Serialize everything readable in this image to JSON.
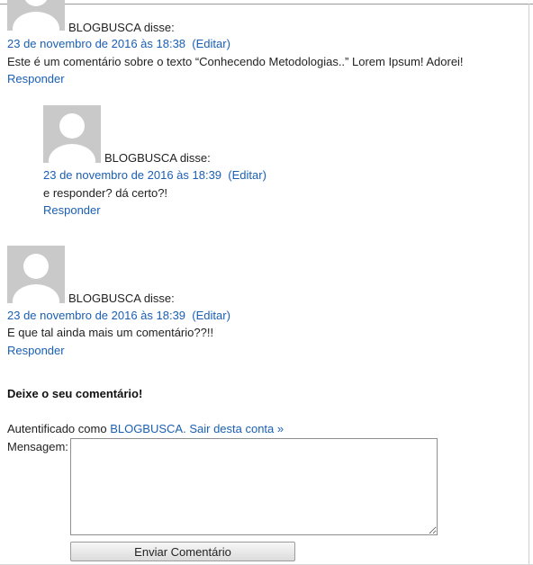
{
  "comments": [
    {
      "author": "BLOGBUSCA",
      "says": " disse:",
      "date": "23 de novembro de 2016 às 18:38",
      "edit": "(Editar)",
      "text": "Este é um comentário sobre o texto “Conhecendo Metodologias..” Lorem Ipsum! Adorei!",
      "reply": "Responder"
    },
    {
      "author": "BLOGBUSCA",
      "says": " disse:",
      "date": "23 de novembro de 2016 às 18:39",
      "edit": "(Editar)",
      "text": "e responder? dá certo?!",
      "reply": "Responder"
    },
    {
      "author": "BLOGBUSCA",
      "says": " disse:",
      "date": "23 de novembro de 2016 às 18:39",
      "edit": "(Editar)",
      "text": "E que tal ainda mais um comentário??!!",
      "reply": "Responder"
    }
  ],
  "form": {
    "title": "Deixe o seu comentário!",
    "logged_prefix": "Autentificado como ",
    "logged_user": "BLOGBUSCA",
    "logout_link": ". Sair desta conta »",
    "message_label": "Mensagem:",
    "message_value": "",
    "submit_label": "Enviar Comentário"
  },
  "colors": {
    "link": "#1a5fb4",
    "avatar_bg": "#c9c9c9",
    "avatar_fg": "#ffffff"
  },
  "icons": {
    "avatar": "default-user-avatar-icon"
  }
}
